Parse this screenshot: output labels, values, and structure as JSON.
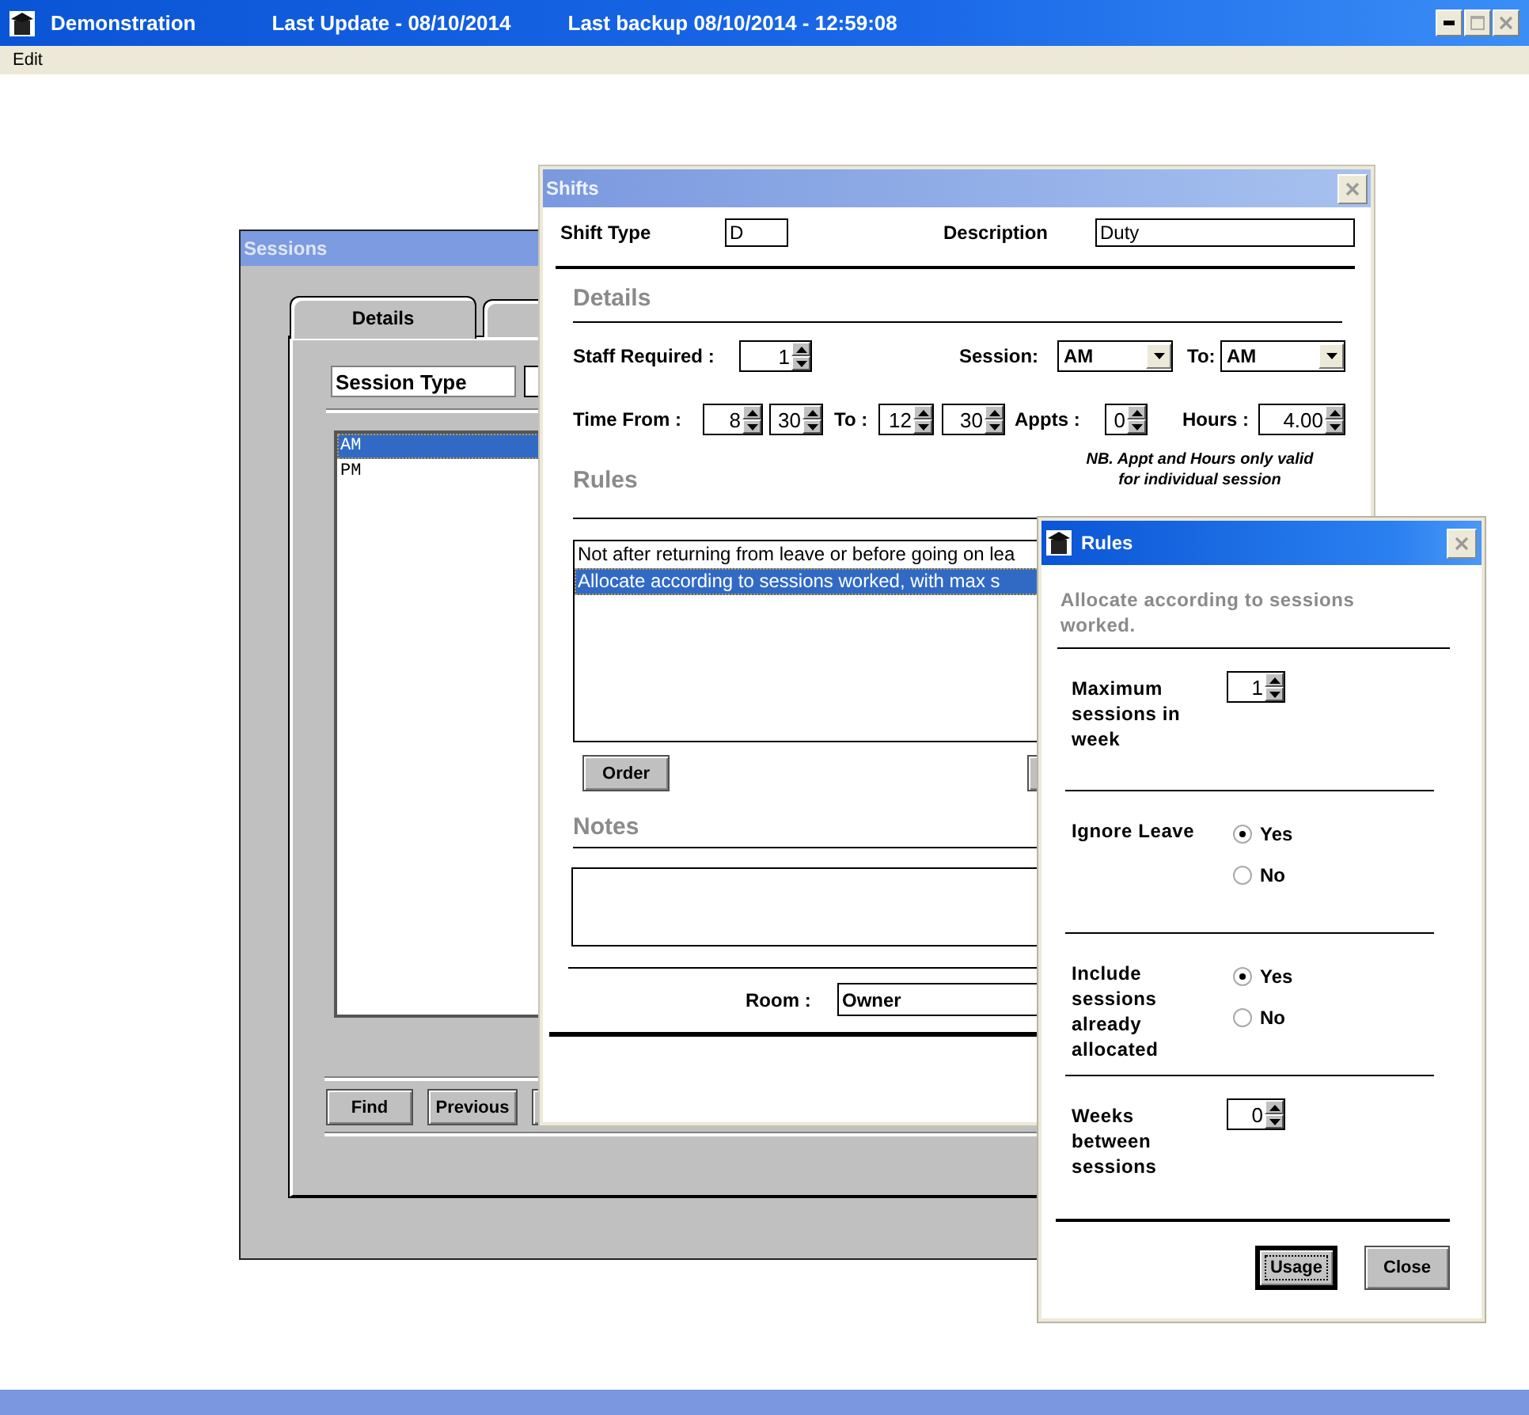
{
  "app_window": {
    "title": "Demonstration",
    "last_update": "Last Update - 08/10/2014",
    "last_backup": "Last backup 08/10/2014 - 12:59:08"
  },
  "menu": [
    {
      "label": "Edit"
    }
  ],
  "sessions_window": {
    "title": "Sessions",
    "tabs": [
      {
        "label": "Details",
        "selected": true
      },
      {
        "selected": false
      }
    ],
    "session_type_label": "Session Type",
    "items": [
      {
        "label": "AM",
        "selected": true
      },
      {
        "label": "PM",
        "selected": false
      }
    ],
    "buttons": [
      {
        "label": "Find"
      },
      {
        "label": "Previous"
      }
    ]
  },
  "shifts_window": {
    "title": "Shifts",
    "shift_type": {
      "label": "Shift Type",
      "value": "D"
    },
    "description": {
      "label": "Description",
      "value": "Duty"
    },
    "details_heading": "Details",
    "staff_required": {
      "label": "Staff Required :",
      "value": "1"
    },
    "session": {
      "label": "Session:",
      "value": "AM"
    },
    "session_to": {
      "label": "To:",
      "value": "AM"
    },
    "time_from": {
      "label": "Time From :",
      "hour": "8",
      "minute": "30"
    },
    "time_to": {
      "label": "To :",
      "hour": "12",
      "minute": "30"
    },
    "appts": {
      "label": "Appts :",
      "value": "0"
    },
    "hours": {
      "label": "Hours :",
      "value": "4.00"
    },
    "note": "NB.  Appt and Hours only valid\nfor individual session",
    "rules_heading": "Rules",
    "rules": [
      {
        "label": "Not after returning from leave or before going on lea",
        "selected": false
      },
      {
        "label": "Allocate according to sessions worked, with max s",
        "selected": true
      }
    ],
    "order_button": "Order",
    "notes_heading": "Notes",
    "room": {
      "label": "Room :",
      "value": "Owner"
    }
  },
  "rules_window": {
    "title": "Rules",
    "heading": "Allocate according to sessions worked.",
    "fields": [
      {
        "kind": "spinner",
        "label": "Maximum sessions in week",
        "value": "1"
      },
      {
        "kind": "radio",
        "label": "Ignore Leave",
        "options": [
          {
            "label": "Yes",
            "selected": true
          },
          {
            "label": "No",
            "selected": false
          }
        ]
      },
      {
        "kind": "radio",
        "label": "Include sessions already allocated",
        "options": [
          {
            "label": "Yes",
            "selected": true
          },
          {
            "label": "No",
            "selected": false
          }
        ]
      },
      {
        "kind": "spinner",
        "label": "Weeks between sessions",
        "value": "0"
      }
    ],
    "buttons": [
      {
        "label": "Usage",
        "focused": true
      },
      {
        "label": "Close",
        "focused": false
      }
    ]
  }
}
